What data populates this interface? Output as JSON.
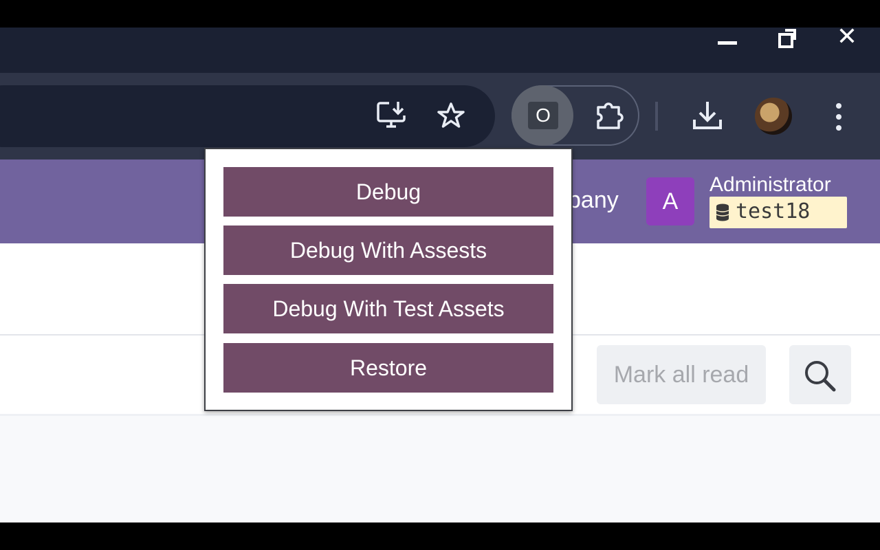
{
  "window_controls": {
    "minimize_icon": "minimize-icon",
    "maximize_icon": "restore-window-icon",
    "close_icon": "close-icon",
    "close_glyph": "✕"
  },
  "toolbar": {
    "icons": [
      "install-app-icon",
      "bookmark-star-icon",
      "puzzle-extensions-icon",
      "download-icon",
      "kebab-menu-icon"
    ],
    "extension_badge": "O"
  },
  "odoo": {
    "navbar_color": "#71639e",
    "company_partial": "pany",
    "user_initial": "A",
    "user_name": "Administrator",
    "database": "test18",
    "mark_all_read": "Mark all read"
  },
  "popup": {
    "button_color": "#714b67",
    "buttons": [
      {
        "label": "Debug"
      },
      {
        "label": "Debug With Assests"
      },
      {
        "label": "Debug With Test Assets"
      },
      {
        "label": "Restore"
      }
    ]
  }
}
